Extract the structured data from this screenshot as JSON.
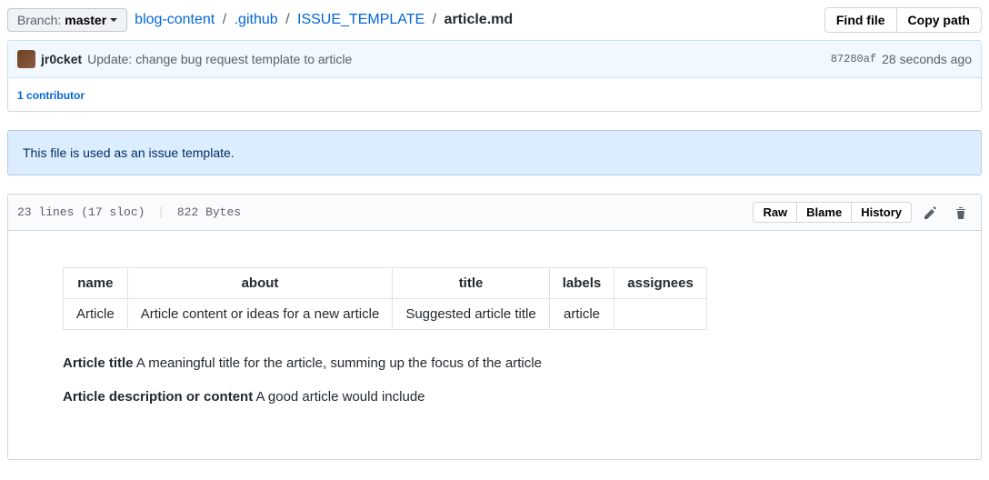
{
  "branch": {
    "label": "Branch:",
    "name": "master"
  },
  "breadcrumbs": {
    "parts": [
      "blog-content",
      ".github",
      "ISSUE_TEMPLATE"
    ],
    "current": "article.md"
  },
  "buttons": {
    "find_file": "Find file",
    "copy_path": "Copy path"
  },
  "commit": {
    "author": "jr0cket",
    "message": "Update: change bug request template to article",
    "sha": "87280af",
    "time": "28 seconds ago"
  },
  "contributors": {
    "count": "1",
    "label": "contributor"
  },
  "notice": "This file is used as an issue template.",
  "file_stats": {
    "lines": "23 lines (17 sloc)",
    "bytes": "822 Bytes"
  },
  "file_buttons": {
    "raw": "Raw",
    "blame": "Blame",
    "history": "History"
  },
  "table": {
    "headers": [
      "name",
      "about",
      "title",
      "labels",
      "assignees"
    ],
    "rows": [
      [
        "Article",
        "Article content or ideas for a new article",
        "Suggested article title",
        "article",
        ""
      ]
    ]
  },
  "article": {
    "title_label": "Article title",
    "title_text": "A meaningful title for the article, summing up the focus of the article",
    "desc_label": "Article description or content",
    "desc_text": "A good article would include"
  }
}
